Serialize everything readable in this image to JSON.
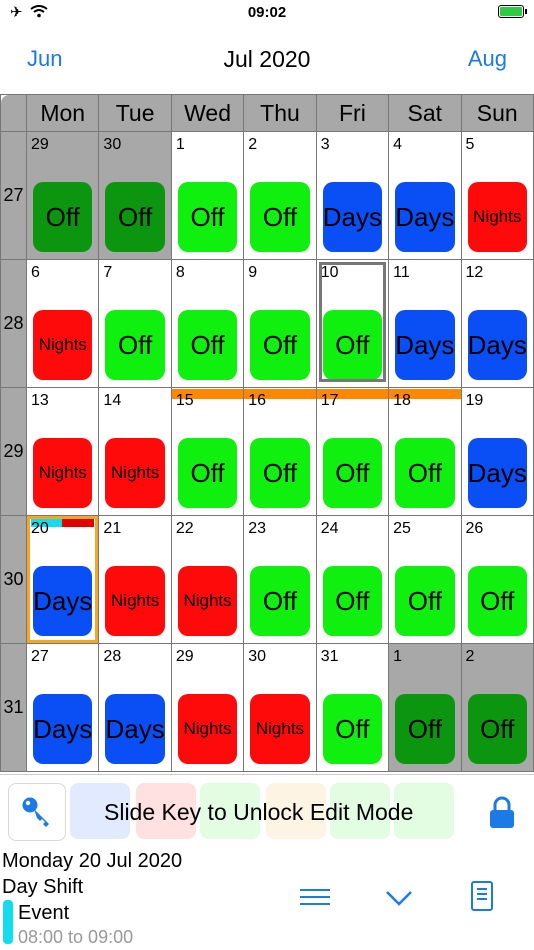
{
  "status_bar": {
    "time": "09:02",
    "icons": [
      "airplane-icon",
      "wifi-icon",
      "battery-charging-icon"
    ]
  },
  "nav": {
    "prev": "Jun",
    "title": "Jul 2020",
    "next": "Aug"
  },
  "weekdays": [
    "Mon",
    "Tue",
    "Wed",
    "Thu",
    "Fri",
    "Sat",
    "Sun"
  ],
  "colors": {
    "off": "#0ff00f",
    "off_out": "#0c9610",
    "days": "#0a4ff5",
    "nights": "#ff0a0a",
    "event_bar": "#ff8800",
    "today": "#f5a623",
    "accent": "#1a7ae6"
  },
  "weeks": [
    {
      "week": "27",
      "days": [
        {
          "n": "29",
          "s": "Off",
          "t": "off",
          "out": true
        },
        {
          "n": "30",
          "s": "Off",
          "t": "off",
          "out": true
        },
        {
          "n": "1",
          "s": "Off",
          "t": "off"
        },
        {
          "n": "2",
          "s": "Off",
          "t": "off"
        },
        {
          "n": "3",
          "s": "Days",
          "t": "days"
        },
        {
          "n": "4",
          "s": "Days",
          "t": "days"
        },
        {
          "n": "5",
          "s": "Nights",
          "t": "nights"
        }
      ]
    },
    {
      "week": "28",
      "days": [
        {
          "n": "6",
          "s": "Nights",
          "t": "nights"
        },
        {
          "n": "7",
          "s": "Off",
          "t": "off"
        },
        {
          "n": "8",
          "s": "Off",
          "t": "off"
        },
        {
          "n": "9",
          "s": "Off",
          "t": "off"
        },
        {
          "n": "10",
          "s": "Off",
          "t": "off",
          "selected": true
        },
        {
          "n": "11",
          "s": "Days",
          "t": "days"
        },
        {
          "n": "12",
          "s": "Days",
          "t": "days"
        }
      ]
    },
    {
      "week": "29",
      "days": [
        {
          "n": "13",
          "s": "Nights",
          "t": "nights"
        },
        {
          "n": "14",
          "s": "Nights",
          "t": "nights"
        },
        {
          "n": "15",
          "s": "Off",
          "t": "off",
          "bar": true
        },
        {
          "n": "16",
          "s": "Off",
          "t": "off",
          "bar": true
        },
        {
          "n": "17",
          "s": "Off",
          "t": "off",
          "bar": true
        },
        {
          "n": "18",
          "s": "Off",
          "t": "off",
          "bar": true
        },
        {
          "n": "19",
          "s": "Days",
          "t": "days"
        }
      ]
    },
    {
      "week": "30",
      "days": [
        {
          "n": "20",
          "s": "Days",
          "t": "days",
          "today": true,
          "marks": true
        },
        {
          "n": "21",
          "s": "Nights",
          "t": "nights"
        },
        {
          "n": "22",
          "s": "Nights",
          "t": "nights"
        },
        {
          "n": "23",
          "s": "Off",
          "t": "off"
        },
        {
          "n": "24",
          "s": "Off",
          "t": "off"
        },
        {
          "n": "25",
          "s": "Off",
          "t": "off"
        },
        {
          "n": "26",
          "s": "Off",
          "t": "off"
        }
      ]
    },
    {
      "week": "31",
      "days": [
        {
          "n": "27",
          "s": "Days",
          "t": "days"
        },
        {
          "n": "28",
          "s": "Days",
          "t": "days"
        },
        {
          "n": "29",
          "s": "Nights",
          "t": "nights"
        },
        {
          "n": "30",
          "s": "Nights",
          "t": "nights"
        },
        {
          "n": "31",
          "s": "Off",
          "t": "off"
        },
        {
          "n": "1",
          "s": "Off",
          "t": "off",
          "out": true
        },
        {
          "n": "2",
          "s": "Off",
          "t": "off",
          "out": true
        }
      ]
    }
  ],
  "lock": {
    "text": "Slide Key to Unlock Edit Mode",
    "key_icon": "key-icon",
    "lock_icon": "lock-icon"
  },
  "detail": {
    "date": "Monday 20 Jul 2020",
    "shift": "Day Shift",
    "event_title": "Event",
    "event_time": "08:00 to 09:00"
  },
  "toolbar": {
    "icons": [
      "menu-icon",
      "chevron-down-icon",
      "notes-icon"
    ]
  }
}
